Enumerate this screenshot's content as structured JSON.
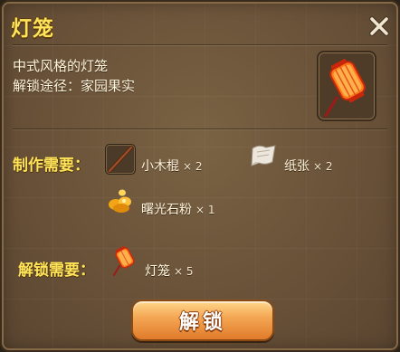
{
  "dialog": {
    "title": "灯笼",
    "close_icon": "close-x-icon"
  },
  "item": {
    "description": "中式风格的灯笼",
    "unlock_path": "解锁途径：家园果实",
    "icon": "lantern-icon"
  },
  "craft": {
    "label": "制作需要：",
    "materials": [
      {
        "name": "小木棍",
        "count": "× 2",
        "icon": "stick-icon"
      },
      {
        "name": "纸张",
        "count": "× 2",
        "icon": "paper-icon"
      },
      {
        "name": "曙光石粉",
        "count": "× 1",
        "icon": "dawnstone-powder-icon"
      }
    ]
  },
  "unlock": {
    "label": "解锁需要：",
    "requirement": {
      "name": "灯笼",
      "count": "× 5",
      "icon": "lantern-icon"
    }
  },
  "button": {
    "label": "解锁"
  },
  "colors": {
    "title": "#ffe45a",
    "panel": "#6a5239",
    "button": "#f3a451"
  }
}
